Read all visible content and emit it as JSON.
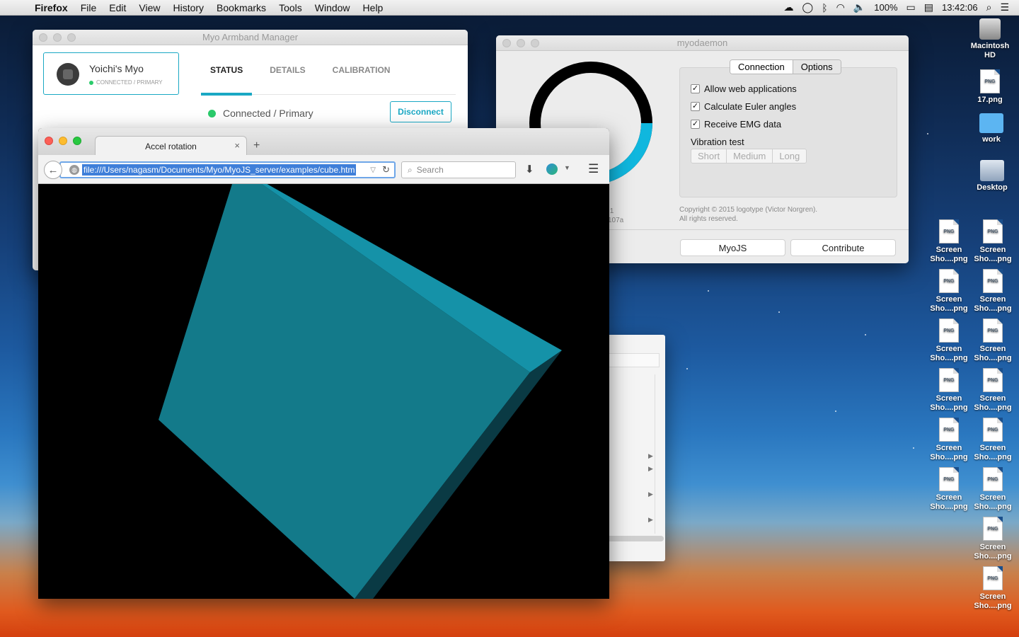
{
  "menubar": {
    "app": "Firefox",
    "items": [
      "File",
      "Edit",
      "View",
      "History",
      "Bookmarks",
      "Tools",
      "Window",
      "Help"
    ],
    "battery": "100%",
    "time": "13:42:06"
  },
  "myo_manager": {
    "title": "Myo Armband Manager",
    "device_name": "Yoichi's Myo",
    "device_status": "CONNECTED / PRIMARY",
    "tabs": [
      "STATUS",
      "DETAILS",
      "CALIBRATION"
    ],
    "connection_status": "Connected / Primary",
    "disconnect_label": "Disconnect"
  },
  "myodaemon": {
    "title": "myodaemon",
    "segments": [
      "Connection",
      "Options"
    ],
    "checkboxes": [
      "Allow web applications",
      "Calculate Euler angles",
      "Receive EMG data"
    ],
    "vibration_label": "Vibration test",
    "vibration_buttons": [
      "Short",
      "Medium",
      "Long"
    ],
    "copyright_line1": "Copyright © 2015 logotype (Victor Norgren).",
    "copyright_line2": "All rights reserved.",
    "version_line1": ".1",
    "version_line2": "107a",
    "buttons": [
      "MyoJS",
      "Contribute"
    ],
    "ring_progress": 0.22
  },
  "firefox": {
    "tab_title": "Accel rotation",
    "url": "file:///Users/nagasm/Documents/Myo/MyoJS_server/examples/cube.htm",
    "search_placeholder": "Search"
  },
  "desktop": {
    "icons": [
      {
        "label": "Macintosh HD",
        "type": "hd"
      },
      {
        "label": "17.png",
        "type": "png"
      },
      {
        "label": "work",
        "type": "folder"
      },
      {
        "label": "Desktop",
        "type": "desk"
      }
    ],
    "screenshot_label": "Screen Sho....png"
  },
  "colors": {
    "accent": "#1aa8c4",
    "cube_face_main": "#137a8a",
    "cube_face_top": "#1592a8"
  }
}
